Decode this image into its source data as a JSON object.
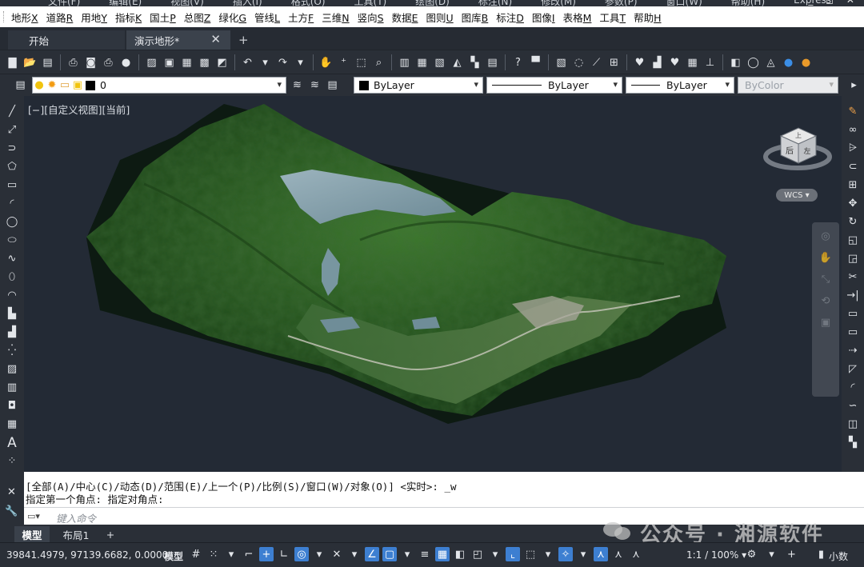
{
  "top_menu_partial": [
    "文件(F)",
    "编辑(E)",
    "视图(V)",
    "插入(I)",
    "格式(O)",
    "工具(T)",
    "绘图(D)",
    "标注(N)",
    "修改(M)",
    "参数(P)",
    "窗口(W)",
    "帮助(H)",
    "Express"
  ],
  "menubar": {
    "items": [
      {
        "label": "地形",
        "key": "X"
      },
      {
        "label": "道路",
        "key": "R"
      },
      {
        "label": "用地",
        "key": "Y"
      },
      {
        "label": "指标",
        "key": "K"
      },
      {
        "label": "国土",
        "key": "P"
      },
      {
        "label": "总图",
        "key": "Z"
      },
      {
        "label": "绿化",
        "key": "G"
      },
      {
        "label": "管线",
        "key": "L"
      },
      {
        "label": "土方",
        "key": "F"
      },
      {
        "label": "三维",
        "key": "N"
      },
      {
        "label": "竖向",
        "key": "S"
      },
      {
        "label": "数据",
        "key": "E"
      },
      {
        "label": "图则",
        "key": "U"
      },
      {
        "label": "图库",
        "key": "B"
      },
      {
        "label": "标注",
        "key": "D"
      },
      {
        "label": "图像",
        "key": "I"
      },
      {
        "label": "表格",
        "key": "M"
      },
      {
        "label": "工具",
        "key": "T"
      },
      {
        "label": "帮助",
        "key": "H"
      }
    ]
  },
  "tabs": {
    "start": "开始",
    "active": "演示地形*",
    "close": "✕",
    "add": "+"
  },
  "layer_toolbar": {
    "layer_value": "0",
    "color_value": "ByLayer",
    "linetype_value": "ByLayer",
    "lineweight_value": "ByLayer",
    "plotstyle_value": "ByColor"
  },
  "viewport": {
    "label": "[−][自定义视图][当前]",
    "viewcube_top": "上",
    "viewcube_front": "后",
    "viewcube_right": "左",
    "wcs": "WCS"
  },
  "command": {
    "history_line1": "[全部(A)/中心(C)/动态(D)/范围(E)/上一个(P)/比例(S)/窗口(W)/对象(O)] <实时>: _w",
    "history_line2": "指定第一个角点: 指定对角点:",
    "prompt_placeholder": "键入命令"
  },
  "layout_tabs": {
    "model": "模型",
    "layout1": "布局1",
    "add": "+"
  },
  "statusbar": {
    "coordinates": "39841.4979, 97139.6682, 0.0000",
    "space": "模型",
    "annotation_scale": "1:1 / 100%",
    "units": "小数"
  },
  "watermark": "公众号 · 湘源软件",
  "colors": {
    "background": "#232a35",
    "toolbar": "#2a2f37",
    "accent_blue": "#3d7fd1"
  }
}
